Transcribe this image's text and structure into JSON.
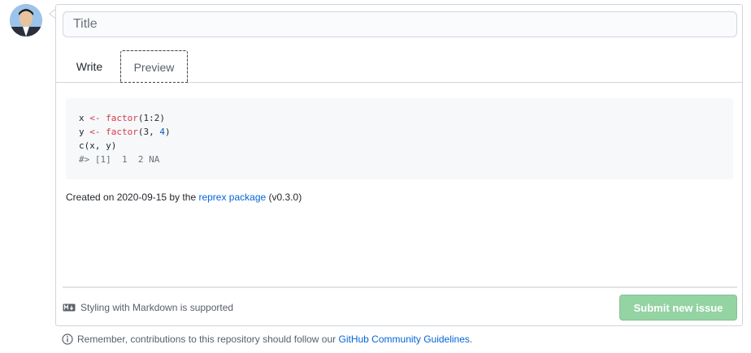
{
  "title_input": {
    "placeholder": "Title",
    "value": ""
  },
  "tabs": {
    "write": "Write",
    "preview": "Preview",
    "active": "Preview"
  },
  "code": {
    "line1": {
      "a": "x ",
      "op": "<-",
      "b": " ",
      "fn": "factor",
      "c": "(1:2)"
    },
    "line2": {
      "a": "y ",
      "op": "<-",
      "b": " ",
      "fn": "factor",
      "c1": "(3, ",
      "num": "4",
      "c2": ")"
    },
    "line3": "c(x, y)",
    "line4": "#> [1]  1  2 NA"
  },
  "created": {
    "prefix": "Created on 2020-09-15 by the ",
    "link": "reprex package",
    "suffix": " (v0.3.0)"
  },
  "footer": {
    "markdown_note": "Styling with Markdown is supported",
    "submit_label": "Submit new issue"
  },
  "remember": {
    "prefix": "Remember, contributions to this repository should follow our ",
    "link": "GitHub Community Guidelines",
    "suffix": "."
  },
  "colors": {
    "accent_link": "#0366d6",
    "submit_disabled": "#94d3a2",
    "code_keyword": "#d73a49",
    "code_number": "#005cc5"
  },
  "icons": {
    "avatar": "user-avatar",
    "markdown": "markdown-icon",
    "info": "info-icon"
  }
}
